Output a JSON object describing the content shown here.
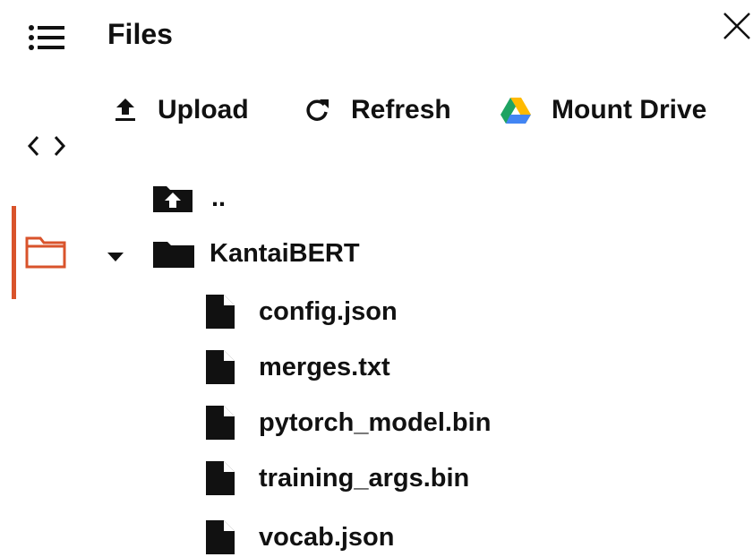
{
  "panel": {
    "title": "Files"
  },
  "toolbar": {
    "upload_label": "Upload",
    "refresh_label": "Refresh",
    "mount_drive_label": "Mount Drive"
  },
  "tree": {
    "parent_label": "..",
    "folder": {
      "name": "KantaiBERT",
      "expanded": true
    },
    "files": [
      "config.json",
      "merges.txt",
      "pytorch_model.bin",
      "training_args.bin",
      "vocab.json"
    ]
  },
  "colors": {
    "accent": "#d9532b",
    "text": "#111111",
    "background": "#ffffff",
    "drive_green": "#1ea362",
    "drive_yellow": "#ffba00",
    "drive_blue": "#4285f4"
  }
}
